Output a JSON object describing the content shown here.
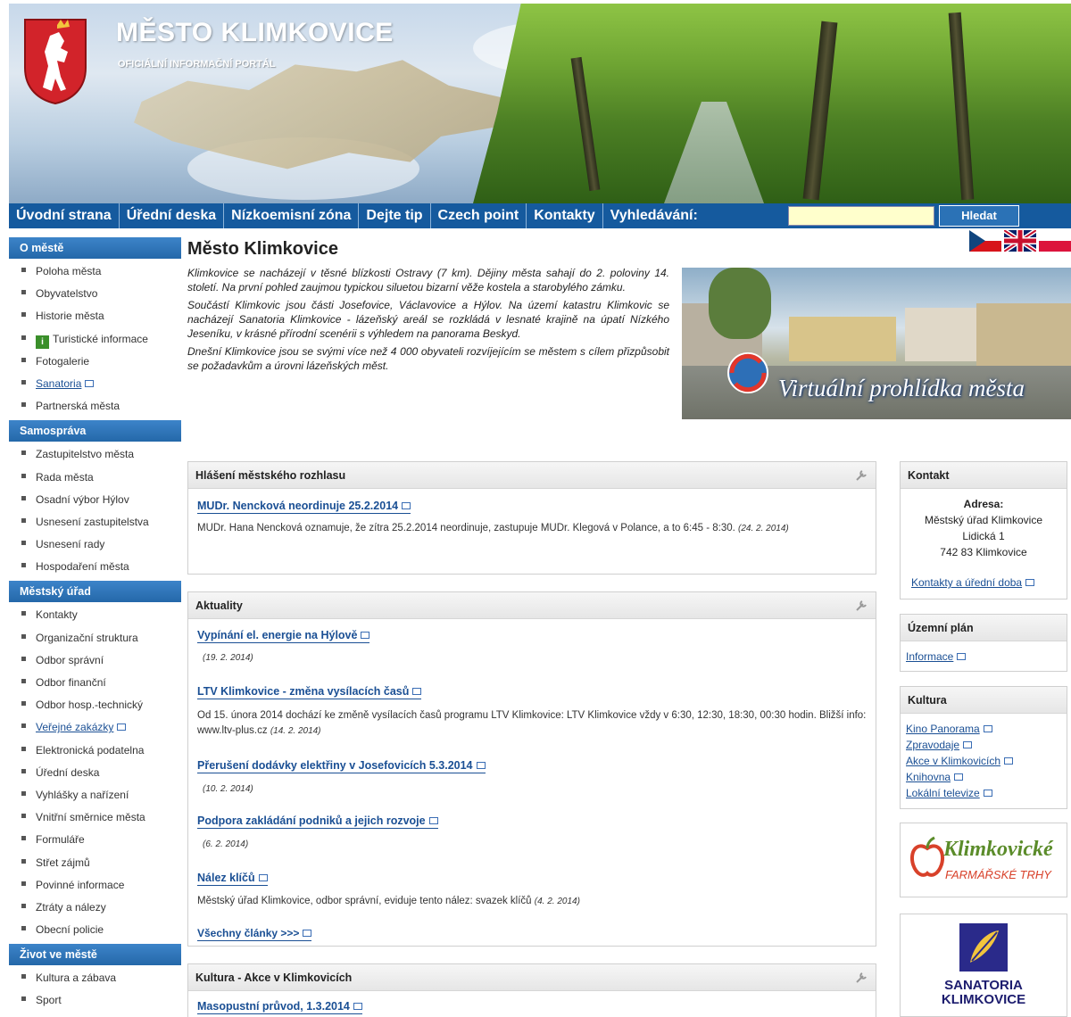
{
  "header": {
    "title": "MĚSTO KLIMKOVICE",
    "subtitle": "OFICIÁLNÍ INFORMAČNÍ PORTÁL"
  },
  "nav": {
    "items": [
      "Úvodní strana",
      "Úřední deska",
      "Nízkoemisní zóna",
      "Dejte tip",
      "Czech point",
      "Kontakty",
      "Vyhledávání:"
    ],
    "search_value": "",
    "search_button": "Hledat"
  },
  "sidebar": {
    "sections": [
      {
        "title": "O městě",
        "items": [
          "Poloha města",
          "Obyvatelstvo",
          "Historie města",
          "Turistické informace",
          "Fotogalerie",
          "Sanatoria",
          "Partnerská města"
        ]
      },
      {
        "title": "Samospráva",
        "items": [
          "Zastupitelstvo města",
          "Rada města",
          "Osadní výbor Hýlov",
          "Usnesení zastupitelstva",
          "Usnesení rady",
          "Hospodaření města"
        ]
      },
      {
        "title": "Městský úřad",
        "items": [
          "Kontakty",
          "Organizační struktura",
          "Odbor správní",
          "Odbor finanční",
          "Odbor hosp.-technický",
          "Veřejné zakázky",
          "Elektronická podatelna",
          "Úřední deska",
          "Vyhlášky a nařízení",
          "Vnitřní směrnice města",
          "Formuláře",
          "Střet zájmů",
          "Povinné informace",
          "Ztráty a nálezy",
          "Obecní policie"
        ]
      },
      {
        "title": "Život ve městě",
        "items": [
          "Kultura a zábava",
          "Sport"
        ]
      }
    ]
  },
  "main": {
    "title": "Město Klimkovice",
    "intro": [
      "Klimkovice se nacházejí v těsné blízkosti Ostravy (7 km). Dějiny města sahají do 2. poloviny 14. století. Na první pohled zaujmou typickou siluetou bizarní věže kostela a starobylého zámku.",
      "Součástí Klimkovic jsou části Josefovice, Václavovice a Hýlov. Na území katastru Klimkovic se nacházejí Sanatoria Klimkovice - lázeňský areál se rozkládá v lesnaté krajině na úpatí Nízkého Jeseníku, v krásné přírodní scenérii s výhledem na panorama Beskyd.",
      "Dnešní Klimkovice jsou se svými více než 4 000 obyvateli rozvíjejícím se městem s cílem přizpůsobit se požadavkům a úrovni lázeňských měst."
    ],
    "virtual_tour": "Virtuální prohlídka města"
  },
  "rozhlas": {
    "title": "Hlášení městského rozhlasu",
    "article_title": "MUDr. Nencková neordinuje 25.2.2014",
    "article_text": "MUDr. Hana Nencková oznamuje, že zítra 25.2.2014 neordinuje, zastupuje MUDr. Klegová v Polance, a to 6:45 - 8:30.",
    "article_date": "(24. 2. 2014)"
  },
  "aktuality": {
    "title": "Aktuality",
    "articles": [
      {
        "title": "Vypínání el. energie na Hýlově",
        "text": "",
        "date": "(19. 2. 2014)"
      },
      {
        "title": "LTV Klimkovice - změna vysílacích časů",
        "text": "Od 15. února 2014 dochází ke změně vysílacích časů programu LTV Klimkovice: LTV Klimkovice vždy v 6:30, 12:30, 18:30, 00:30 hodin. Bližší info: www.ltv-plus.cz",
        "date": "(14. 2. 2014)"
      },
      {
        "title": "Přerušení dodávky elektřiny v Josefovicích 5.3.2014",
        "text": "",
        "date": "(10. 2. 2014)"
      },
      {
        "title": "Podpora zakládání podniků a jejich rozvoje",
        "text": "",
        "date": "(6. 2. 2014)"
      },
      {
        "title": "Nález klíčů",
        "text": "Městský úřad Klimkovice, odbor správní, eviduje tento nález: svazek klíčů",
        "date": "(4. 2. 2014)"
      }
    ],
    "all_link": "Všechny články >>>"
  },
  "kultura_akce": {
    "title": "Kultura - Akce v Klimkovicích",
    "article_title": "Masopustní průvod, 1.3.2014"
  },
  "kontakt": {
    "title": "Kontakt",
    "address_label": "Adresa:",
    "lines": [
      "Městský úřad Klimkovice",
      "Lidická 1",
      "742 83 Klimkovice"
    ],
    "link": "Kontakty a úřední doba"
  },
  "uzemni": {
    "title": "Územní plán",
    "link": "Informace"
  },
  "kultura": {
    "title": "Kultura",
    "links": [
      "Kino Panorama",
      "Zpravodaje",
      "Akce v Klimkovicích",
      "Knihovna",
      "Lokální televize"
    ]
  },
  "banners": {
    "farm_line1": "Klimkovické",
    "farm_line2": "FARMÁŘSKÉ TRHY",
    "sanatoria_line1": "SANATORIA",
    "sanatoria_line2": "KLIMKOVICE"
  },
  "colors": {
    "nav_blue": "#155a9e",
    "sidebar_head": "#2b72b6",
    "link": "#1a4f94",
    "search_bg": "#ffffcc"
  }
}
